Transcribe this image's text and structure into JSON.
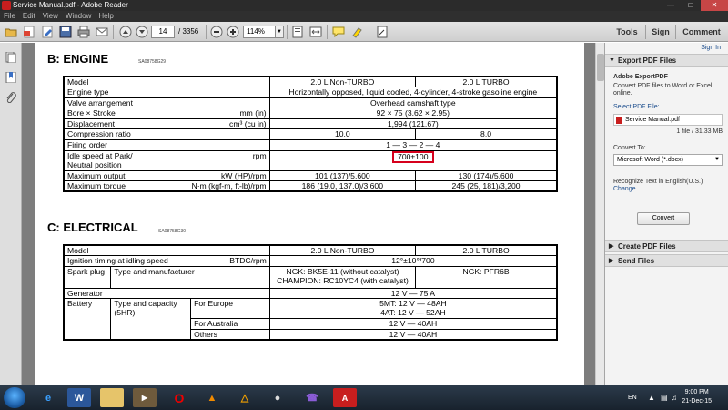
{
  "window": {
    "title": "Service Manual.pdf - Adobe Reader"
  },
  "menu": [
    "File",
    "Edit",
    "View",
    "Window",
    "Help"
  ],
  "toolbar": {
    "page_current": "14",
    "page_total": "/ 3356",
    "zoom": "114%",
    "tools_label": "Tools",
    "sign_label": "Sign",
    "comment_label": "Comment"
  },
  "document": {
    "engine": {
      "title": "B:  ENGINE",
      "code": "SA08758G29",
      "header": [
        "Model",
        "2.0 L Non-TURBO",
        "2.0 L TURBO"
      ],
      "rows": [
        {
          "label": "Engine type",
          "unit": "",
          "value": "Horizontally opposed, liquid cooled, 4-cylinder, 4-stroke gasoline engine"
        },
        {
          "label": "Valve arrangement",
          "unit": "",
          "value": "Overhead camshaft type"
        },
        {
          "label": "Bore × Stroke",
          "unit": "mm (in)",
          "value": "92 × 75 (3.62 × 2.95)"
        },
        {
          "label": "Displacement",
          "unit": "cm³ (cu in)",
          "value": "1,994 (121.67)"
        },
        {
          "label": "Compression ratio",
          "unit": "",
          "v1": "10.0",
          "v2": "8.0"
        },
        {
          "label": "Firing order",
          "unit": "",
          "value": "1 — 3 — 2 — 4"
        },
        {
          "label": "Idle speed at Park/",
          "label2": "Neutral position",
          "unit": "rpm",
          "value": "700±100"
        },
        {
          "label": "Maximum output",
          "unit": "kW (HP)/rpm",
          "v1": "101 (137)/5,600",
          "v2": "130 (174)/5,600"
        },
        {
          "label": "Maximum torque",
          "unit": "N·m (kgf-m, ft-lb)/rpm",
          "v1": "186 (19.0, 137.0)/3,600",
          "v2": "245 (25, 181)/3,200"
        }
      ]
    },
    "electrical": {
      "title": "C:  ELECTRICAL",
      "code": "SA08758G30",
      "header": [
        "Model",
        "2.0 L Non-TURBO",
        "2.0 L TURBO"
      ],
      "ignition": {
        "label": "Ignition timing at idling speed",
        "unit": "BTDC/rpm",
        "value": "12°±10°/700"
      },
      "spark": {
        "label": "Spark plug",
        "sub": "Type and manufacturer",
        "v1a": "NGK: BK5E-11 (without catalyst)",
        "v1b": "CHAMPION: RC10YC4 (with catalyst)",
        "v2": "NGK: PFR6B"
      },
      "generator": {
        "label": "Generator",
        "value": "12 V — 75 A"
      },
      "battery": {
        "label": "Battery",
        "sub1": "Type and capacity",
        "sub2": "(5HR)",
        "europe_label": "For Europe",
        "europe_a": "5MT: 12 V — 48AH",
        "europe_b": "4AT: 12 V — 52AH",
        "australia_label": "For Australia",
        "australia": "12 V — 40AH",
        "others_label": "Others",
        "others": "12 V — 40AH"
      }
    }
  },
  "panel": {
    "sign_in": "Sign In",
    "export_head": "Export PDF Files",
    "export_title": "Adobe ExportPDF",
    "export_desc1": "Convert PDF files to Word or Excel",
    "export_desc2": "online.",
    "select_label": "Select PDF File:",
    "file_name": "Service Manual.pdf",
    "file_info": "1 file / 31.33 MB",
    "convert_to": "Convert To:",
    "format": "Microsoft Word (*.docx)",
    "recognize": "Recognize Text in English(U.S.)",
    "change": "Change",
    "convert_btn": "Convert",
    "create_head": "Create PDF Files",
    "send_head": "Send Files"
  },
  "taskbar": {
    "lang": "EN",
    "time": "9:00 PM",
    "date": "21-Dec-15"
  },
  "colors": {
    "highlight": "#d6001c",
    "accent": "#1a4c8c"
  }
}
